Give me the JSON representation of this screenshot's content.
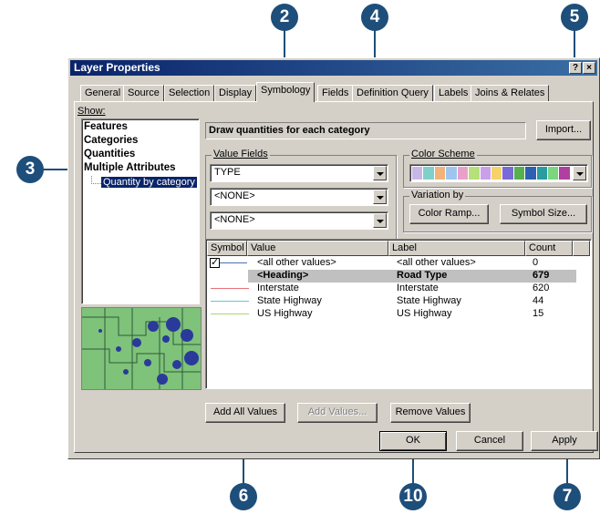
{
  "callouts": {
    "c2": "2",
    "c3": "3",
    "c4": "4",
    "c5": "5",
    "c6": "6",
    "c7": "7",
    "c10": "10"
  },
  "window": {
    "title": "Layer Properties",
    "help_btn": "?",
    "close_btn": "×"
  },
  "tabs": [
    "General",
    "Source",
    "Selection",
    "Display",
    "Symbology",
    "Fields",
    "Definition Query",
    "Labels",
    "Joins & Relates"
  ],
  "show": {
    "label": "Show:",
    "items": [
      "Features",
      "Categories",
      "Quantities",
      "Multiple Attributes"
    ],
    "subitem": "Quantity by category"
  },
  "header": {
    "title": "Draw quantities for each category",
    "import_label": "Import..."
  },
  "value_fields": {
    "label": "Value Fields",
    "fields": [
      "TYPE",
      "<NONE>",
      "<NONE>"
    ]
  },
  "color_scheme": {
    "label": "Color Scheme",
    "colors": [
      "#c7b7e6",
      "#7fd0c8",
      "#f2b37a",
      "#9ec5f0",
      "#e8a0c8",
      "#b5e07a",
      "#c9a0e8",
      "#f6d36a",
      "#7a6ad6",
      "#56b050",
      "#2f5fb0",
      "#2a9da0",
      "#7ad67f",
      "#b040a0"
    ]
  },
  "variation_by": {
    "label": "Variation by",
    "color_ramp": "Color Ramp...",
    "symbol_size": "Symbol Size..."
  },
  "table": {
    "columns": [
      "Symbol",
      "Value",
      "Label",
      "Count"
    ],
    "rows": [
      {
        "value": "<all other values>",
        "label": "<all other values>",
        "count": "0",
        "color": "#4a6fb0",
        "checked": true,
        "bold": false,
        "highlight": false
      },
      {
        "value": "<Heading>",
        "label": "Road Type",
        "count": "679",
        "color": "",
        "checked": false,
        "bold": true,
        "highlight": true
      },
      {
        "value": "Interstate",
        "label": "Interstate",
        "count": "620",
        "color": "#e8707a",
        "checked": false,
        "bold": false,
        "highlight": false
      },
      {
        "value": "State Highway",
        "label": "State Highway",
        "count": "44",
        "color": "#60c8d0",
        "checked": false,
        "bold": false,
        "highlight": false
      },
      {
        "value": "US Highway",
        "label": "US Highway",
        "count": "15",
        "color": "#a8d870",
        "checked": false,
        "bold": false,
        "highlight": false
      }
    ]
  },
  "actions": {
    "add_all": "Add All Values",
    "add": "Add Values...",
    "remove": "Remove Values"
  },
  "footer": {
    "ok": "OK",
    "cancel": "Cancel",
    "apply": "Apply"
  },
  "colors": {
    "callout": "#1e4e7a",
    "dialog": "#d4d0c8",
    "title_start": "#0a246a",
    "title_end": "#3a6ea5"
  }
}
